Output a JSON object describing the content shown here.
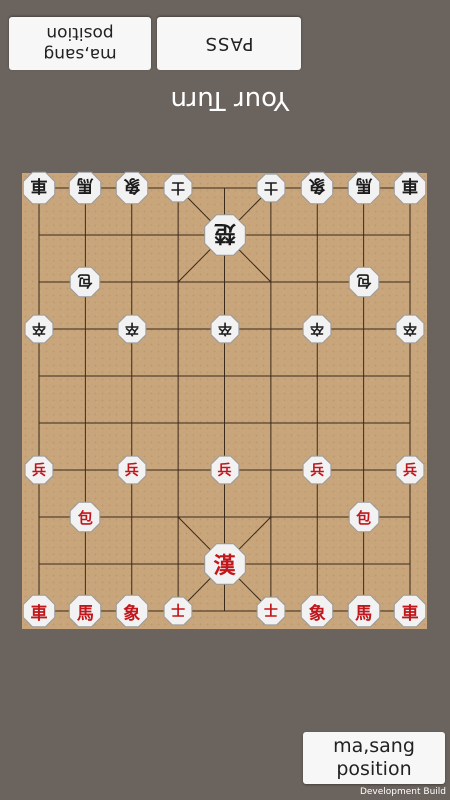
{
  "opponent": {
    "position_button": "ma,sang position",
    "pass_button": "PASS",
    "turn_label": "Your Turn"
  },
  "player": {
    "position_button": "ma,sang position"
  },
  "footer": {
    "build_label": "Development Build"
  },
  "board": {
    "files": 9,
    "ranks": 10,
    "pieces": [
      {
        "side": "black",
        "type": "cha",
        "char": "車",
        "file": 0,
        "rank": 0
      },
      {
        "side": "black",
        "type": "ma",
        "char": "馬",
        "file": 1,
        "rank": 0
      },
      {
        "side": "black",
        "type": "sang",
        "char": "象",
        "file": 2,
        "rank": 0
      },
      {
        "side": "black",
        "type": "sa",
        "char": "士",
        "file": 3,
        "rank": 0
      },
      {
        "side": "black",
        "type": "sa",
        "char": "士",
        "file": 5,
        "rank": 0
      },
      {
        "side": "black",
        "type": "sang",
        "char": "象",
        "file": 6,
        "rank": 0
      },
      {
        "side": "black",
        "type": "ma",
        "char": "馬",
        "file": 7,
        "rank": 0
      },
      {
        "side": "black",
        "type": "cha",
        "char": "車",
        "file": 8,
        "rank": 0
      },
      {
        "side": "black",
        "type": "general",
        "char": "楚",
        "file": 4,
        "rank": 1
      },
      {
        "side": "black",
        "type": "po",
        "char": "包",
        "file": 1,
        "rank": 2
      },
      {
        "side": "black",
        "type": "po",
        "char": "包",
        "file": 7,
        "rank": 2
      },
      {
        "side": "black",
        "type": "jol",
        "char": "卒",
        "file": 0,
        "rank": 3
      },
      {
        "side": "black",
        "type": "jol",
        "char": "卒",
        "file": 2,
        "rank": 3
      },
      {
        "side": "black",
        "type": "jol",
        "char": "卒",
        "file": 4,
        "rank": 3
      },
      {
        "side": "black",
        "type": "jol",
        "char": "卒",
        "file": 6,
        "rank": 3
      },
      {
        "side": "black",
        "type": "jol",
        "char": "卒",
        "file": 8,
        "rank": 3
      },
      {
        "side": "red",
        "type": "byeong",
        "char": "兵",
        "file": 0,
        "rank": 6
      },
      {
        "side": "red",
        "type": "byeong",
        "char": "兵",
        "file": 2,
        "rank": 6
      },
      {
        "side": "red",
        "type": "byeong",
        "char": "兵",
        "file": 4,
        "rank": 6
      },
      {
        "side": "red",
        "type": "byeong",
        "char": "兵",
        "file": 6,
        "rank": 6
      },
      {
        "side": "red",
        "type": "byeong",
        "char": "兵",
        "file": 8,
        "rank": 6
      },
      {
        "side": "red",
        "type": "po",
        "char": "包",
        "file": 1,
        "rank": 7
      },
      {
        "side": "red",
        "type": "po",
        "char": "包",
        "file": 7,
        "rank": 7
      },
      {
        "side": "red",
        "type": "general",
        "char": "漢",
        "file": 4,
        "rank": 8
      },
      {
        "side": "red",
        "type": "cha",
        "char": "車",
        "file": 0,
        "rank": 9
      },
      {
        "side": "red",
        "type": "ma",
        "char": "馬",
        "file": 1,
        "rank": 9
      },
      {
        "side": "red",
        "type": "sang",
        "char": "象",
        "file": 2,
        "rank": 9
      },
      {
        "side": "red",
        "type": "sa",
        "char": "士",
        "file": 3,
        "rank": 9
      },
      {
        "side": "red",
        "type": "sa",
        "char": "士",
        "file": 5,
        "rank": 9
      },
      {
        "side": "red",
        "type": "sang",
        "char": "象",
        "file": 6,
        "rank": 9
      },
      {
        "side": "red",
        "type": "ma",
        "char": "馬",
        "file": 7,
        "rank": 9
      },
      {
        "side": "red",
        "type": "cha",
        "char": "車",
        "file": 8,
        "rank": 9
      }
    ]
  },
  "colors": {
    "background": "#6b635d",
    "board": "#c8a57a",
    "grid_line": "#3a2a1a",
    "piece_face": "#f2f2f2",
    "red_piece": "#c0171c",
    "black_piece": "#1c1c1c"
  }
}
